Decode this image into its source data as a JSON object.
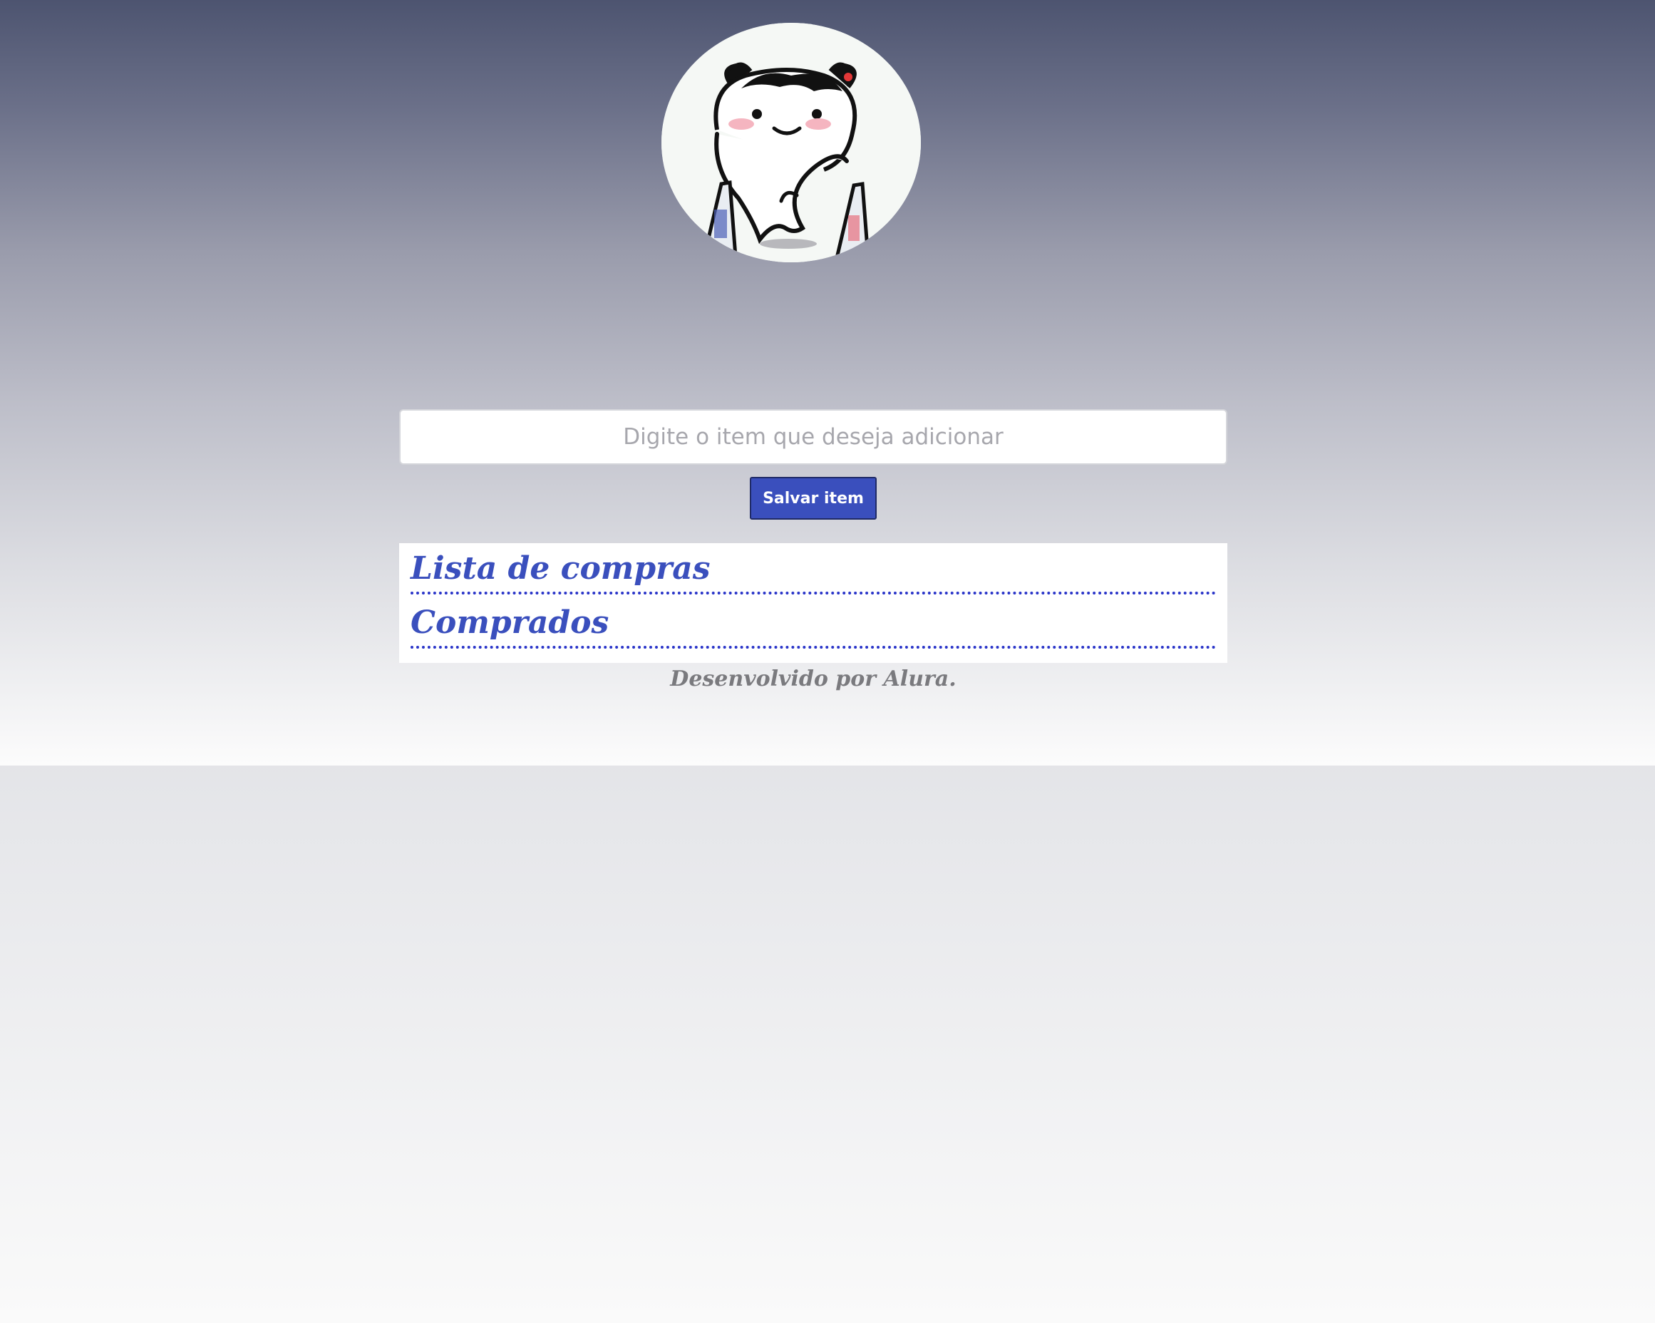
{
  "header": {
    "avatar_icon": "shopping-girl-illustration"
  },
  "form": {
    "input_value": "",
    "input_placeholder": "Digite o item que deseja adicionar",
    "save_label": "Salvar item"
  },
  "lists": {
    "shopping_title": "Lista de compras",
    "shopping_items": [],
    "purchased_title": "Comprados",
    "purchased_items": []
  },
  "footer": {
    "text": "Desenvolvido por Alura."
  },
  "colors": {
    "accent": "#3a4fbd",
    "dotted_border": "#2a35c9",
    "footer_text": "#7a7a7e"
  }
}
